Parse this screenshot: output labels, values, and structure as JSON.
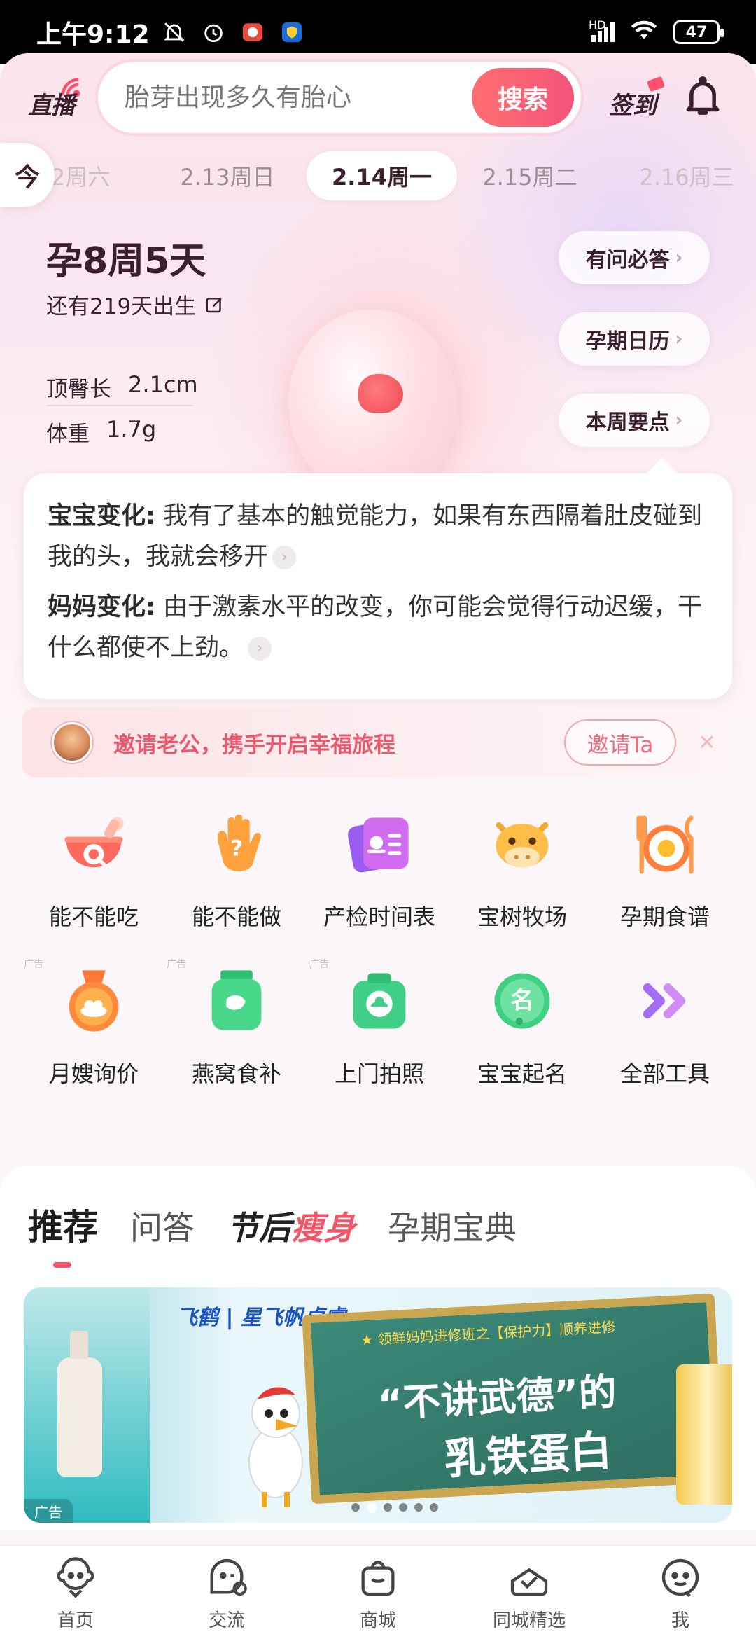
{
  "status_bar": {
    "time": "上午9:12",
    "network": "HD",
    "battery": "47"
  },
  "header": {
    "live_label": "直播",
    "search_placeholder": "胎芽出现多久有胎心",
    "search_button": "搜索",
    "checkin_label": "签到"
  },
  "date_strip": {
    "today_label": "今",
    "dates": [
      {
        "label": "12周六",
        "state": "fade"
      },
      {
        "label": "2.13周日",
        "state": "normal"
      },
      {
        "label": "2.14周一",
        "state": "active"
      },
      {
        "label": "2.15周二",
        "state": "normal"
      },
      {
        "label": "2.16周三",
        "state": "fade"
      }
    ]
  },
  "pregnancy": {
    "week_label": "孕8周5天",
    "days_left": "还有219天出生",
    "crl_label": "顶臀长",
    "crl_value": "2.1cm",
    "weight_label": "体重",
    "weight_value": "1.7g"
  },
  "side_links": {
    "qa": "有问必答",
    "calendar": "孕期日历",
    "weekly": "本周要点"
  },
  "changes": {
    "baby_tag": "宝宝变化:",
    "baby_text": "我有了基本的触觉能力，如果有东西隔着肚皮碰到我的头，我就会移开",
    "mom_tag": "妈妈变化:",
    "mom_text": "由于激素水平的改变，你可能会觉得行动迟缓，干什么都使不上劲。"
  },
  "invite": {
    "text": "邀请老公，携手开启幸福旅程",
    "button": "邀请Ta",
    "close": "✕"
  },
  "tools": {
    "ad_tag": "广告",
    "row1": [
      {
        "label": "能不能吃"
      },
      {
        "label": "能不能做"
      },
      {
        "label": "产检时间表"
      },
      {
        "label": "宝树牧场"
      },
      {
        "label": "孕期食谱"
      }
    ],
    "row2": [
      {
        "label": "月嫂询价"
      },
      {
        "label": "燕窝食补"
      },
      {
        "label": "上门拍照"
      },
      {
        "label": "宝宝起名"
      },
      {
        "label": "全部工具"
      }
    ]
  },
  "feed_tabs": {
    "recommend": "推荐",
    "qa": "问答",
    "festival_a": "节后",
    "festival_b": "瘦身",
    "canon": "孕期宝典"
  },
  "ad_banner": {
    "brand": "飞鹤 | 星飞帆卓睿",
    "board_sub": "★ 领鲜妈妈进修班之【保护力】顺养进修",
    "board_line1": "“不讲武德”的",
    "board_line2": "乳铁蛋白",
    "ad_label": "广告"
  },
  "bottom_nav": {
    "home": "首页",
    "community": "交流",
    "mall": "商城",
    "local": "同城精选",
    "me": "我"
  }
}
